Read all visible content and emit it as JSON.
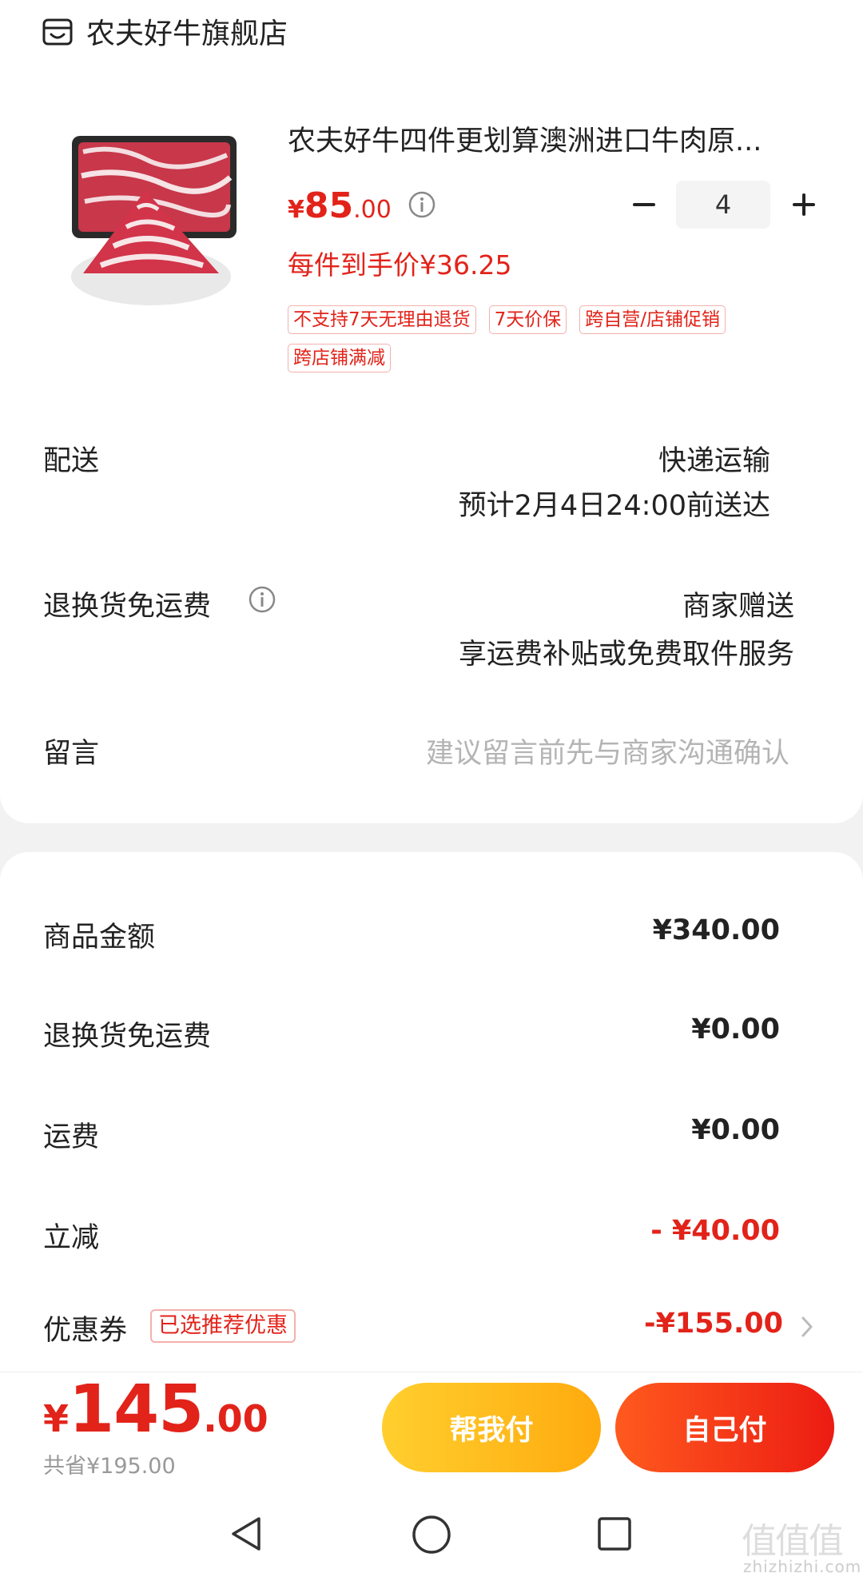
{
  "shop": {
    "name": "农夫好牛旗舰店",
    "icon": "shop-icon"
  },
  "product": {
    "title": "农夫好牛四件更划算澳洲进口牛肉原...",
    "price_symbol": "¥",
    "price_int": "85",
    "price_dec": ".00",
    "unit_price_text": "每件到手价¥36.25",
    "quantity": "4",
    "tags": [
      "不支持7天无理由退货",
      "7天价保",
      "跨自营/店铺促销",
      "跨店铺满减"
    ]
  },
  "delivery": {
    "label": "配送",
    "method": "快递运输",
    "eta": "预计2月4日24:00前送达"
  },
  "return_shipping": {
    "label": "退换货免运费",
    "value": "商家赠送",
    "desc": "享运费补贴或免费取件服务"
  },
  "message": {
    "label": "留言",
    "placeholder": "建议留言前先与商家沟通确认"
  },
  "summary": {
    "goods_label": "商品金额",
    "goods_value": "¥340.00",
    "return_label": "退换货免运费",
    "return_value": "¥0.00",
    "shipping_label": "运费",
    "shipping_value": "¥0.00",
    "discount_label": "立减",
    "discount_value": "- ¥40.00",
    "coupon_label": "优惠券",
    "coupon_badge": "已选推荐优惠",
    "coupon_value": "-¥155.00"
  },
  "checkout": {
    "total_symbol": "¥",
    "total_int": "145",
    "total_dec": ".00",
    "saved_text": "共省¥195.00",
    "help_pay_label": "帮我付",
    "self_pay_label": "自己付"
  },
  "watermark": {
    "glyphs": "值值值",
    "url": "zhizhizhi.com"
  },
  "colors": {
    "accent_red": "#e2231a",
    "yellow_btn": "#ffbb1e",
    "red_btn": "#f0321a",
    "muted_gray": "#999999"
  }
}
